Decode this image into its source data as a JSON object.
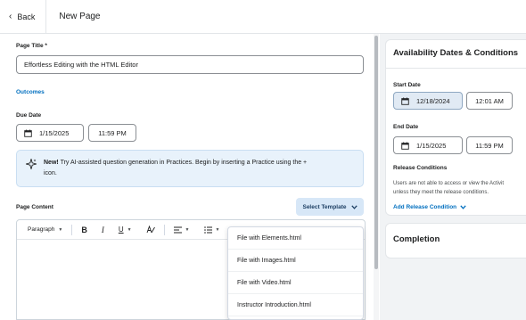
{
  "topbar": {
    "back_label": "Back",
    "page_title": "New Page"
  },
  "form": {
    "title_label": "Page Title",
    "required_mark": "*",
    "title_value": "Effortless Editing with the HTML Editor",
    "outcomes_link": "Outcomes",
    "due_label": "Due Date",
    "due_date": "1/15/2025",
    "due_time": "11:59 PM",
    "alert": {
      "bold": "New!",
      "text": "Try AI-assisted question generation in Practices. Begin by inserting a Practice using the +",
      "text2": "icon."
    },
    "content_label": "Page Content",
    "select_template": "Select Template"
  },
  "toolbar": {
    "paragraph": "Paragraph",
    "bold": "B",
    "italic": "I",
    "underline": "U"
  },
  "template_options": [
    "File with Elements.html",
    "File with Images.html",
    "File with Video.html",
    "Instructor Introduction.html"
  ],
  "side": {
    "availability_title": "Availability Dates & Conditions",
    "start_label": "Start Date",
    "start_date": "12/18/2024",
    "start_time": "12:01 AM",
    "end_label": "End Date",
    "end_date": "1/15/2025",
    "end_time": "11:59 PM",
    "release_label": "Release Conditions",
    "release_text1": "Users are not able to access or view the Activit",
    "release_text2": "unless they meet the release conditions.",
    "add_release": "Add Release Condition",
    "completion_title": "Completion"
  },
  "colors": {
    "link": "#006fbf",
    "alert_bg": "#e8f2fb",
    "template_btn_bg": "#d7e7f7",
    "side_bg": "#f1f3f5"
  }
}
